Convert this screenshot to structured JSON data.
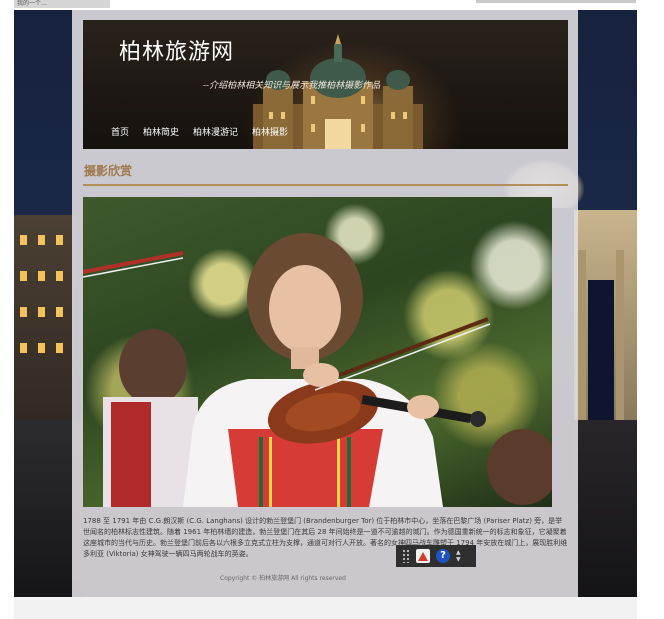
{
  "browser": {
    "tab_label": "我的一个…"
  },
  "header": {
    "site_title": "柏林旅游网",
    "subtitle": "--介绍柏林相关知识与展示我推柏林摄影作品",
    "nav": [
      "首页",
      "柏林简史",
      "柏林漫游记",
      "柏林摄影"
    ]
  },
  "section": {
    "title": "摄影欣赏"
  },
  "content": {
    "description": "1788 至 1791 年由 C.G.朗汉斯 (C.G. Langhans) 设计的勃兰登堡门 (Brandenburger Tor) 位于柏林市中心，坐落在巴黎广场 (Pariser Platz) 旁，是举世闻名的柏林标志性建筑。随着 1961 年柏林墙的建造，勃兰登堡门在其后 28 年间始终是一道不可逾越的城门。作为德国重新统一的标志和象征，它凝聚着这座城市的当代与历史。勃兰登堡门前后各以六根多立克式立柱为支撑，通道可对行人开放。著名的女神四马战车雕塑于 1794 年安放在城门上，展现胜利维多利亚 (Viktoria) 女神驾驶一辆四马两轮战车的英姿。",
    "copyright": "Copyright © 柏林旅游网 All rights reserved"
  },
  "toolbar": {
    "icons": [
      "grip-icon",
      "pdf-icon",
      "help-icon",
      "arrows-icon"
    ],
    "help_glyph": "?"
  },
  "colors": {
    "accent": "#a0784a",
    "rule": "#b58f5b",
    "panel": "#e2e0e4"
  }
}
